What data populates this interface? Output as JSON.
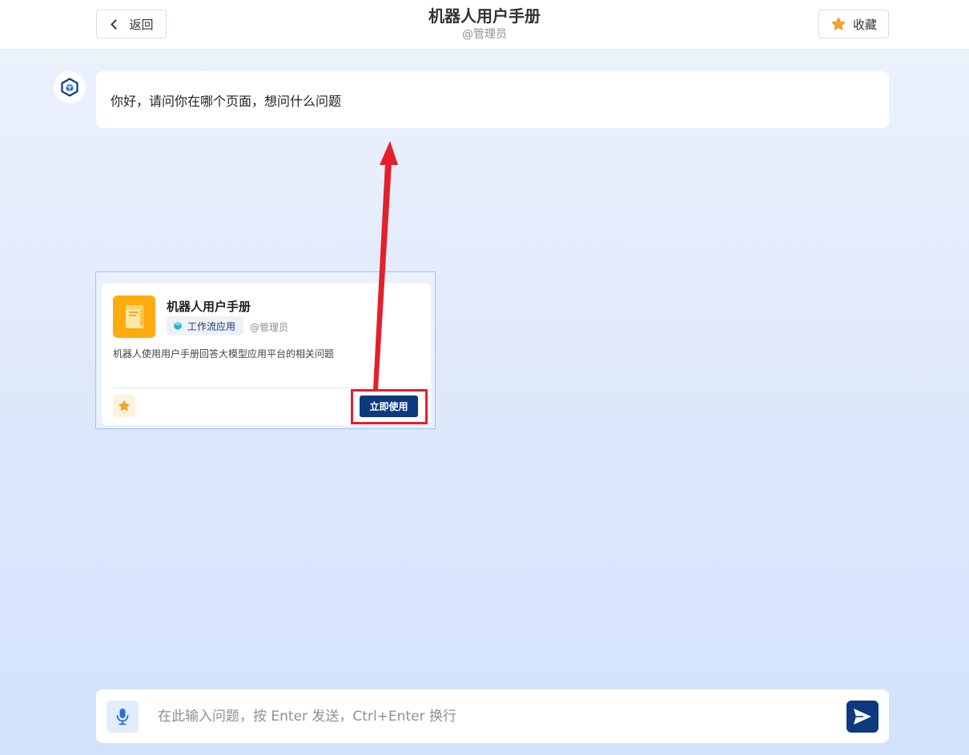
{
  "header": {
    "back_label": "返回",
    "title": "机器人用户手册",
    "owner": "@管理员",
    "favorite_label": "收藏"
  },
  "chat": {
    "bot_message": "你好，请问你在哪个页面，想问什么问题"
  },
  "app_card": {
    "title": "机器人用户手册",
    "tag": "工作流应用",
    "owner": "@管理员",
    "description": "机器人使用用户手册回答大模型应用平台的相关问题",
    "use_button": "立即使用"
  },
  "input": {
    "placeholder": "在此输入问题，按 Enter 发送，Ctrl+Enter 换行",
    "value": ""
  },
  "colors": {
    "accent": "#0d3a7e",
    "star": "#f5a623",
    "annotation": "#e3202b",
    "app_icon_bg": "#fdab0f"
  },
  "icons": [
    "chevron-left-icon",
    "star-icon",
    "bot-logo-icon",
    "notebook-icon",
    "cube-icon",
    "microphone-icon",
    "send-icon"
  ]
}
